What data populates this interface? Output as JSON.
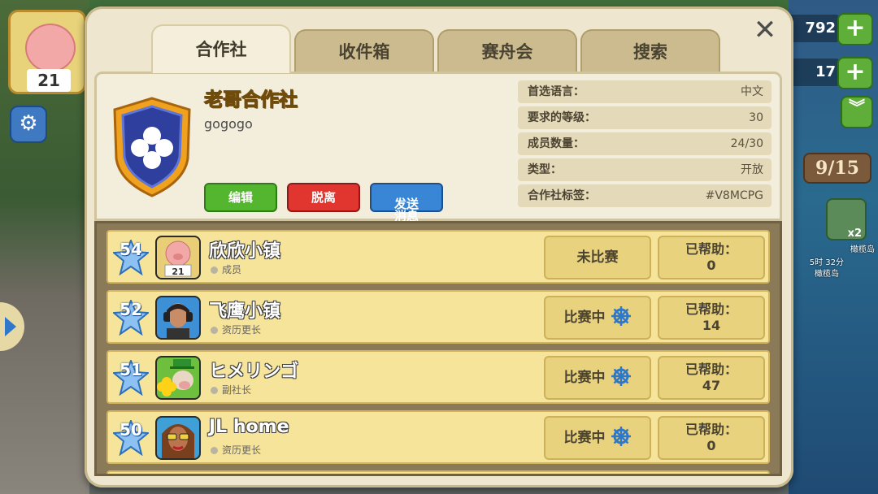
{
  "hud": {
    "res_top": "792",
    "res_mid": "17",
    "plus_icon": "+",
    "chevron": "⌄⌄",
    "counter": "9/15",
    "boost": "x2",
    "timer": "5时 32分",
    "map_label_1": "橄榄岛",
    "map_label_2": "橄榄岛",
    "calendar_day": "21"
  },
  "dialog": {
    "close": "✕",
    "tabs": [
      "合作社",
      "收件箱",
      "赛舟会",
      "搜索"
    ],
    "active_tab": 0
  },
  "club": {
    "name": "老哥合作社",
    "description": "gogogo",
    "buttons": {
      "edit": "编辑",
      "leave": "脱离",
      "message": "发送\n消息"
    },
    "properties": [
      {
        "key": "首选语言：",
        "value": "中文"
      },
      {
        "key": "要求的等级：",
        "value": "30"
      },
      {
        "key": "成员数量：",
        "value": "24/30"
      },
      {
        "key": "类型：",
        "value": "开放"
      },
      {
        "key": "合作社标签：",
        "value": "#V8MCPG"
      }
    ]
  },
  "members": [
    {
      "level": "54",
      "name": "欣欣小镇",
      "role": "成员",
      "status": "未比赛",
      "racing": false,
      "help_label": "已帮助：",
      "help_value": "0",
      "avatar": "pig-calendar"
    },
    {
      "level": "52",
      "name": "飞鹰小镇",
      "role": "资历更长",
      "status": "比赛中",
      "racing": true,
      "help_label": "已帮助：",
      "help_value": "14",
      "avatar": "man-headphones"
    },
    {
      "level": "51",
      "name": "ヒメリンゴ",
      "role": "副社长",
      "status": "比赛中",
      "racing": true,
      "help_label": "已帮助：",
      "help_value": "47",
      "avatar": "cow-clover"
    },
    {
      "level": "50",
      "name": "JL home",
      "role": "资历更长",
      "status": "比赛中",
      "racing": true,
      "help_label": "已帮助：",
      "help_value": "0",
      "avatar": "woman-sunglasses"
    }
  ],
  "colors": {
    "accent_green": "#54b52f",
    "accent_red": "#e0362f",
    "accent_blue": "#3a86d6",
    "title_orange": "#f2a21b",
    "row_yellow": "#f5e49a"
  }
}
